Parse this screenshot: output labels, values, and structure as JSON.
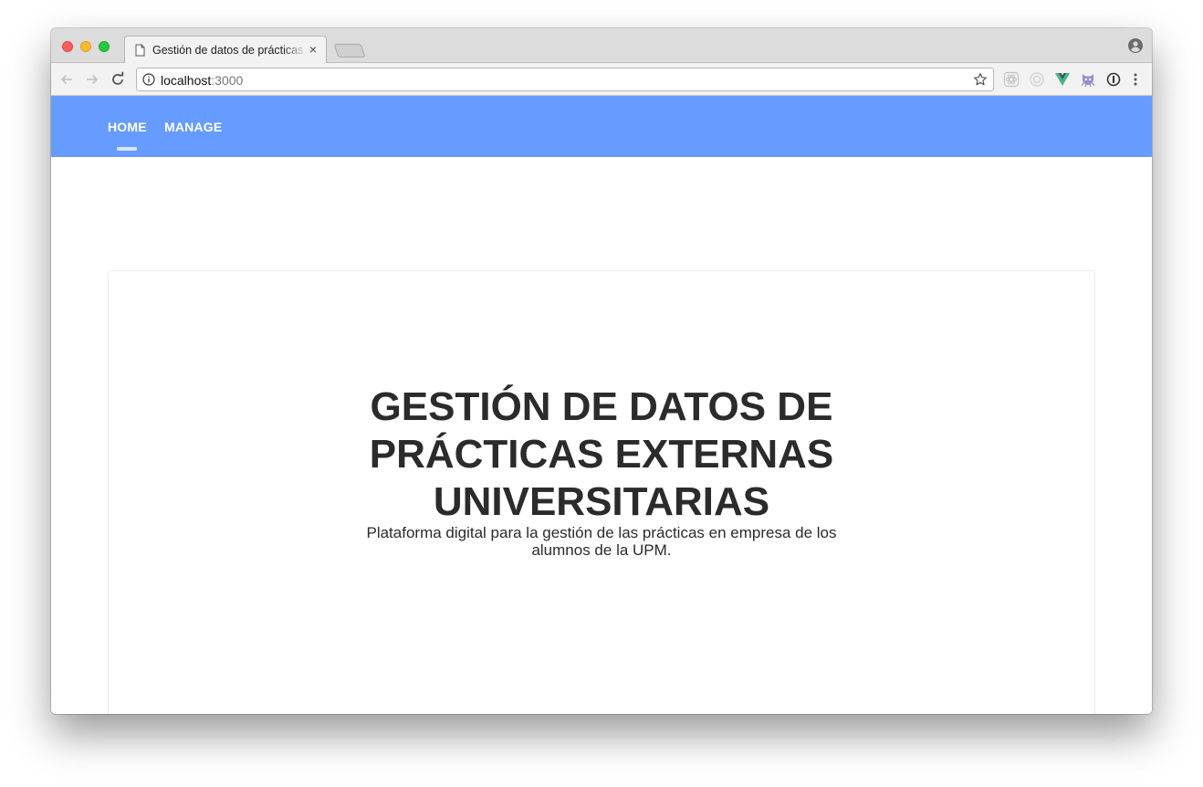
{
  "browser": {
    "tab_title": "Gestión de datos de prácticas externas universitarias",
    "tab_close_symbol": "×",
    "url_host": "localhost",
    "url_port": ":3000",
    "icons": [
      "file-icon",
      "close-icon",
      "profile-icon",
      "back-arrow-icon",
      "forward-arrow-icon",
      "reload-icon",
      "info-icon",
      "star-icon",
      "react-devtools-icon",
      "redux-devtools-icon",
      "vue-devtools-icon",
      "github-cat-icon",
      "1password-icon",
      "more-icon"
    ]
  },
  "nav": {
    "items": [
      {
        "label": "HOME",
        "active": true
      },
      {
        "label": "MANAGE",
        "active": false
      }
    ],
    "bar_color": "#669cff"
  },
  "hero": {
    "title": "GESTIÓN DE DATOS DE PRÁCTICAS EXTERNAS UNIVERSITARIAS",
    "subtitle": "Plataforma digital para la gestión de las prácticas en empresa de los alumnos de la UPM."
  }
}
